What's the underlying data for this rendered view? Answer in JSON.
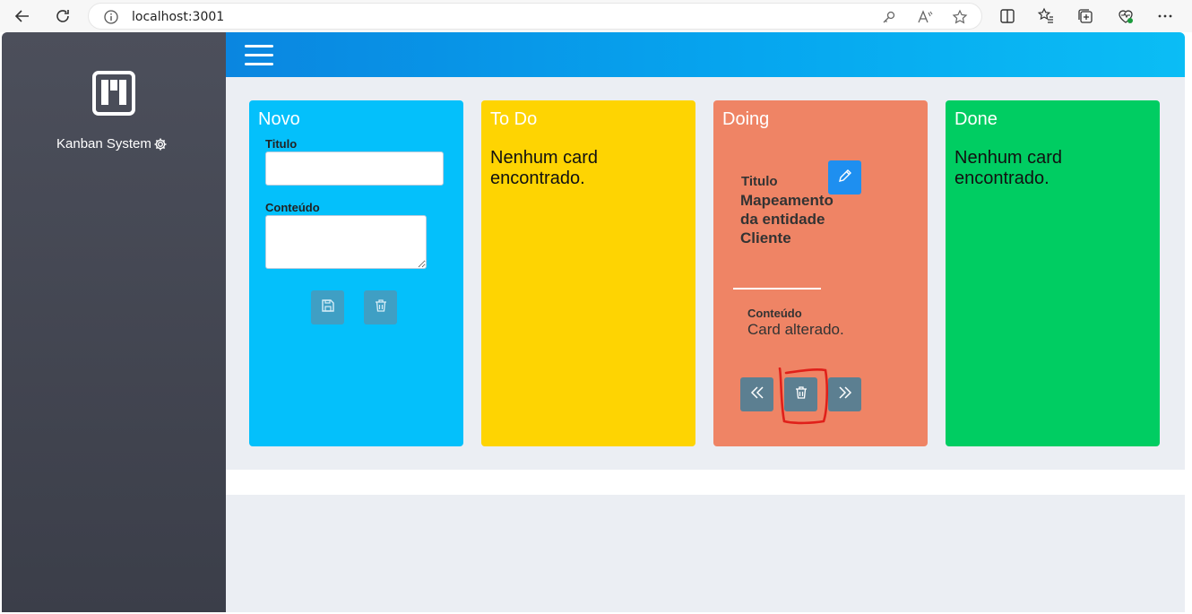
{
  "browser": {
    "url": "localhost:3001",
    "icons": [
      "back-icon",
      "reload-icon",
      "info-icon",
      "key-icon",
      "read-aloud-icon",
      "favorite-star-icon",
      "split-screen-icon",
      "favorites-list-icon",
      "collections-icon",
      "browser-essentials-icon",
      "more-icon"
    ]
  },
  "sidebar": {
    "brand": "Kanban System",
    "icons": [
      "kanban-logo-icon",
      "gear-icon"
    ]
  },
  "topbar": {
    "icons": [
      "hamburger-menu-icon"
    ]
  },
  "columns": {
    "novo": {
      "title": "Novo",
      "titulo_label": "Titulo",
      "conteudo_label": "Conteúdo",
      "titulo_value": "",
      "conteudo_value": "",
      "color": "#04c0fb",
      "buttons": [
        "save-icon",
        "trash-icon"
      ]
    },
    "todo": {
      "title": "To Do",
      "empty": "Nenhum card encontrado.",
      "color": "#fed402"
    },
    "doing": {
      "title": "Doing",
      "color": "#ef8465",
      "card": {
        "titulo_label": "Titulo",
        "title": "Mapeamento da entidade Cliente",
        "conteudo_label": "Conteúdo",
        "content": "Card alterado.",
        "buttons": [
          "edit-pencil-icon",
          "move-left-icon",
          "trash-icon",
          "move-right-icon"
        ]
      }
    },
    "done": {
      "title": "Done",
      "empty": "Nenhum card encontrado.",
      "color": "#00cd62"
    }
  },
  "annotation": {
    "color": "#e0201a",
    "shape": "hand-drawn circle around delete button"
  }
}
